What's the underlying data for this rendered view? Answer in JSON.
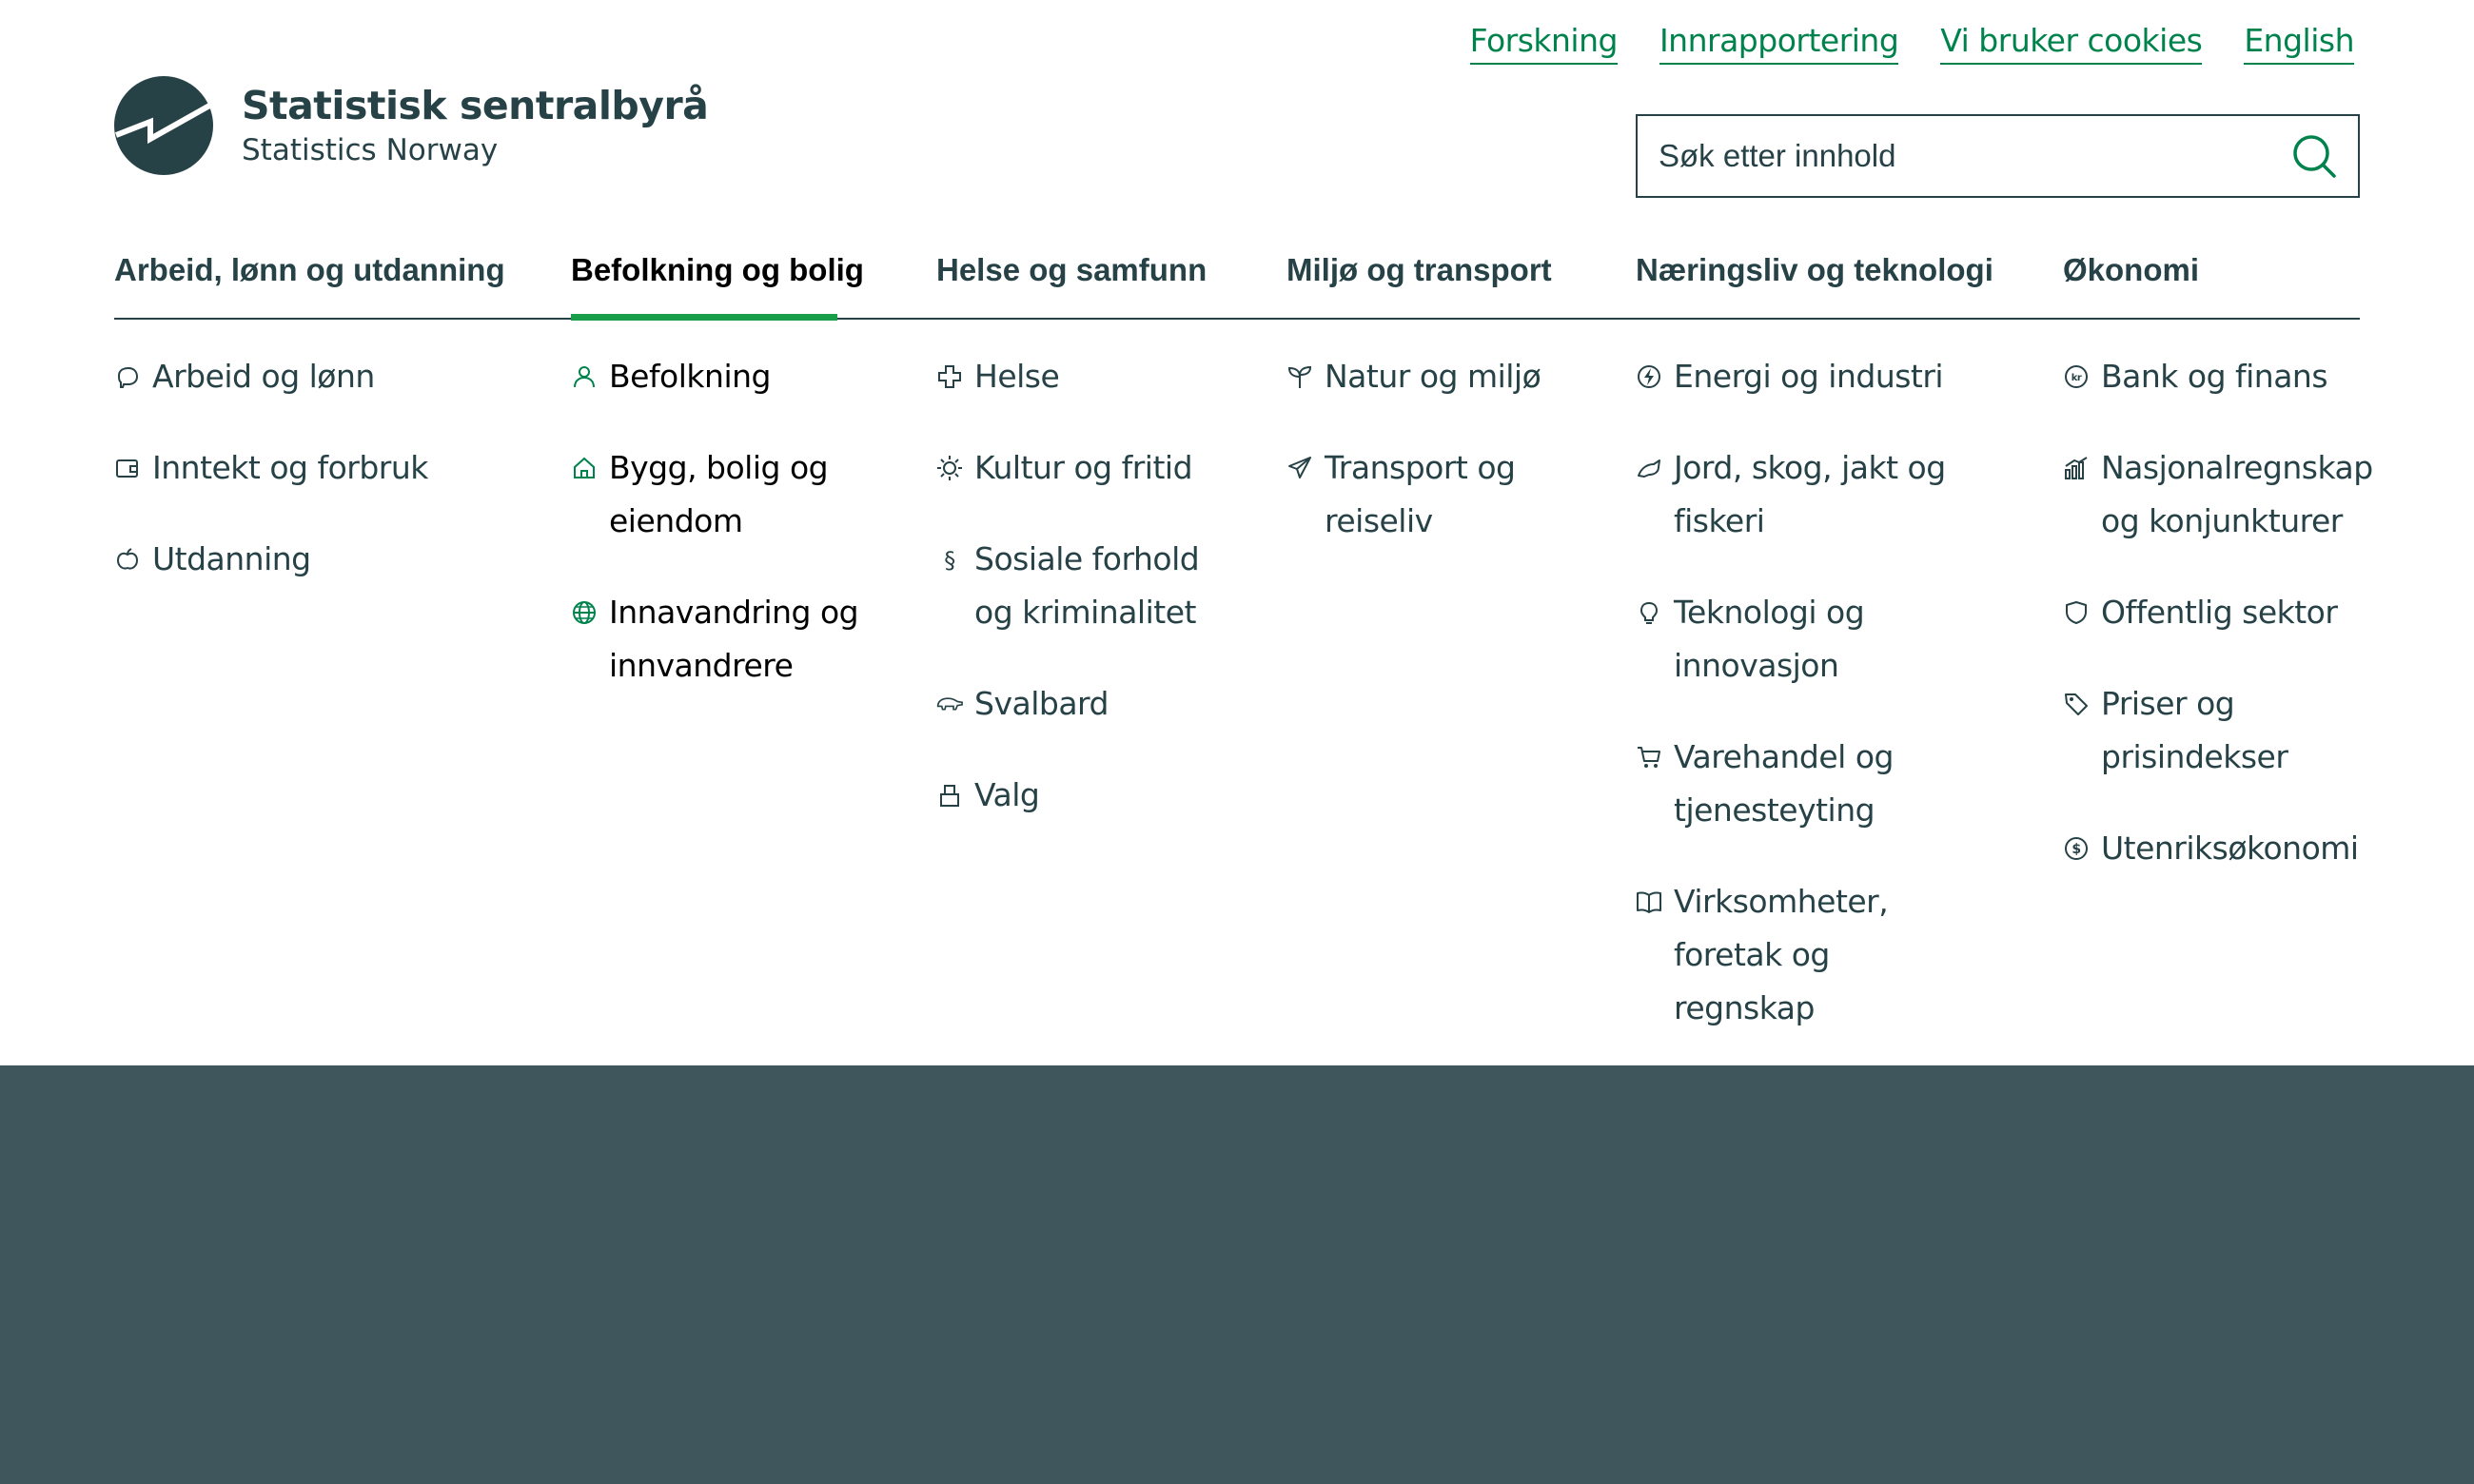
{
  "top_links": [
    "Forskning",
    "Innrapportering",
    "Vi bruker cookies",
    "English"
  ],
  "logo": {
    "title": "Statistisk sentralbyrå",
    "subtitle": "Statistics Norway"
  },
  "search": {
    "placeholder": "Søk etter innhold"
  },
  "tabs": [
    "Arbeid, lønn og utdanning",
    "Befolkning og bolig",
    "Helse og samfunn",
    "Miljø og transport",
    "Næringsliv og teknologi",
    "Økonomi"
  ],
  "active_tab": "Befolkning og bolig",
  "menu": {
    "arbeid": [
      {
        "label": "Arbeid og lønn",
        "icon": "piggy-bank-icon"
      },
      {
        "label": "Inntekt og forbruk",
        "icon": "wallet-icon"
      },
      {
        "label": "Utdanning",
        "icon": "apple-icon"
      }
    ],
    "befolkning": [
      {
        "label": "Befolkning",
        "icon": "person-icon"
      },
      {
        "label": "Bygg, bolig og eiendom",
        "icon": "house-icon"
      },
      {
        "label": "Innavandring og innvandrere",
        "icon": "globe-icon"
      }
    ],
    "helse": [
      {
        "label": "Helse",
        "icon": "cross-icon"
      },
      {
        "label": "Kultur og fritid",
        "icon": "sun-icon"
      },
      {
        "label": "Sosiale forhold og kriminalitet",
        "icon": "paragraph-icon"
      },
      {
        "label": "Svalbard",
        "icon": "polar-bear-icon"
      },
      {
        "label": "Valg",
        "icon": "ballot-box-icon"
      }
    ],
    "miljo": [
      {
        "label": "Natur og miljø",
        "icon": "sprout-icon"
      },
      {
        "label": "Transport og reiseliv",
        "icon": "airplane-icon"
      }
    ],
    "naeringsliv": [
      {
        "label": "Energi og industri",
        "icon": "energy-icon"
      },
      {
        "label": "Jord, skog, jakt og fiskeri",
        "icon": "fish-icon"
      },
      {
        "label": "Teknologi og innovasjon",
        "icon": "lightbulb-icon"
      },
      {
        "label": "Varehandel og tjenesteyting",
        "icon": "cart-icon"
      },
      {
        "label": "Virksomheter, foretak og regnskap",
        "icon": "book-icon"
      }
    ],
    "okonomi": [
      {
        "label": "Bank og finans",
        "icon": "kr-coin-icon"
      },
      {
        "label": "Nasjonalregnskap og konjunkturer",
        "icon": "bar-chart-icon"
      },
      {
        "label": "Offentlig sektor",
        "icon": "shield-icon"
      },
      {
        "label": "Priser og prisindekser",
        "icon": "price-tag-icon"
      },
      {
        "label": "Utenriksøkonomi",
        "icon": "dollar-coin-icon"
      }
    ]
  },
  "colors": {
    "link_green": "#00824d",
    "tab_indicator": "#1a9d49",
    "text_dark_teal": "#274247",
    "footer_bg": "#3f575c"
  }
}
